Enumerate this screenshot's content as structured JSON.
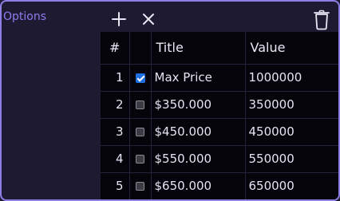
{
  "panel": {
    "label": "Options",
    "accent_color": "#8b7cf0",
    "border_color": "#8c7fe6"
  },
  "toolbar": {
    "add_icon": "plus-icon",
    "remove_icon": "close-icon",
    "delete_icon": "trash-icon"
  },
  "table": {
    "headers": {
      "num": "#",
      "title": "Title",
      "value": "Value"
    },
    "rows": [
      {
        "num": "1",
        "checked": true,
        "title": "Max Price",
        "value": "1000000"
      },
      {
        "num": "2",
        "checked": false,
        "title": "$350.000",
        "value": "350000"
      },
      {
        "num": "3",
        "checked": false,
        "title": "$450.000",
        "value": "450000"
      },
      {
        "num": "4",
        "checked": false,
        "title": "$550.000",
        "value": "550000"
      },
      {
        "num": "5",
        "checked": false,
        "title": "$650.000",
        "value": "650000"
      }
    ]
  }
}
